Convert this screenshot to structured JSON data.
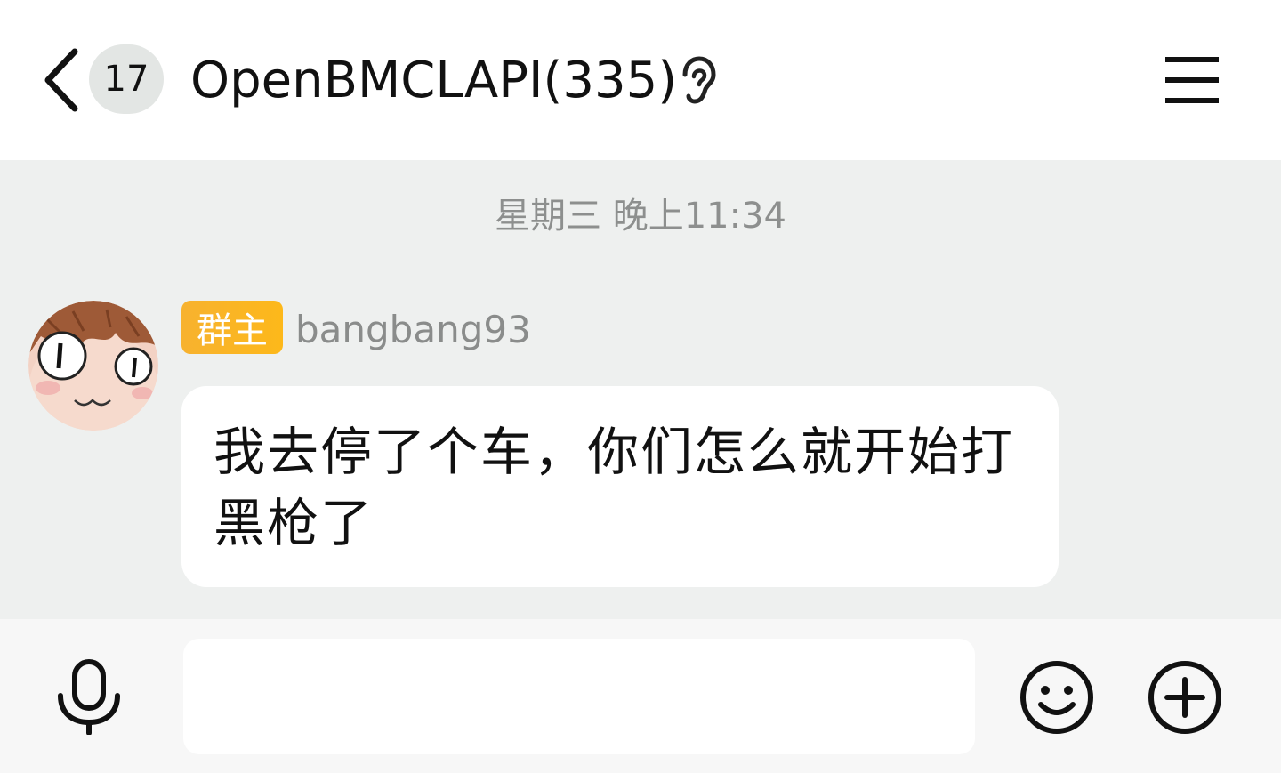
{
  "header": {
    "back_icon": "chevron-left-icon",
    "unread_count": "17",
    "title": "OpenBMCLAPI(335)",
    "ear_icon": "ear-icon",
    "menu_icon": "hamburger-menu-icon"
  },
  "chat": {
    "timestamp": "星期三 晚上11:34",
    "messages": [
      {
        "sender_badge": "群主",
        "sender_name": "bangbang93",
        "avatar": "anime-face-avatar",
        "text": "我去停了个车，你们怎么就开始打黑枪了"
      }
    ]
  },
  "input_bar": {
    "voice_icon": "microphone-icon",
    "message_placeholder": "",
    "emoji_icon": "smiley-icon",
    "plus_icon": "plus-circle-icon"
  },
  "colors": {
    "chat_background": "#eef0ef",
    "owner_badge": "#fdb81a",
    "badge_bg": "#e3e6e4"
  }
}
